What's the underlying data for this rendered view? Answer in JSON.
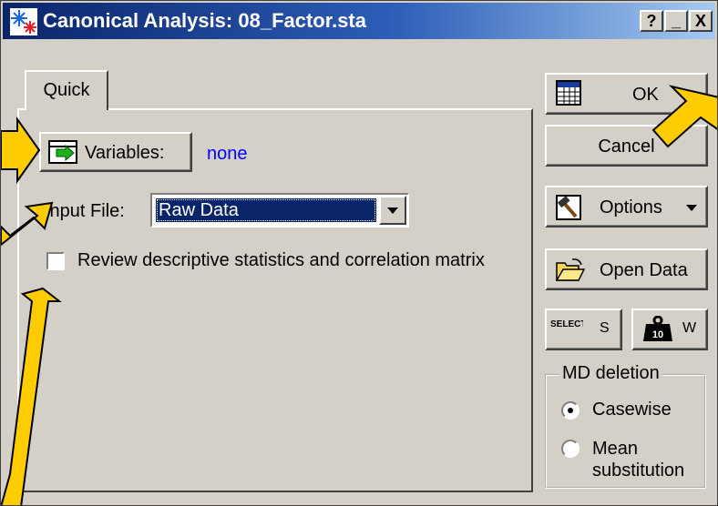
{
  "window": {
    "title": "Canonical Analysis: 08_Factor.sta",
    "help_button": "?",
    "minimize_button": "_",
    "close_button": "X"
  },
  "tabs": [
    {
      "label": "Quick",
      "selected": true
    }
  ],
  "quick": {
    "variables_button": "Variables:",
    "variables_value": "none",
    "input_file_label": "Input File:",
    "input_file_value": "Raw Data",
    "review_checkbox_label": "Review descriptive statistics and correlation matrix",
    "review_checked": false
  },
  "side_buttons": {
    "ok": "OK",
    "cancel": "Cancel",
    "options": "Options",
    "open_data": "Open Data",
    "select_cases_icon_text": "SELECT CASES",
    "select_cases_key": "S",
    "weight_icon_text": "10",
    "weight_key": "W"
  },
  "md_deletion": {
    "title": "MD deletion",
    "options": [
      "Casewise",
      "Mean substitution"
    ],
    "selected": "Casewise"
  },
  "colors": {
    "dialog": "#d4d0c8",
    "titlebar": "#0a246a",
    "link": "#0000ff",
    "highlight": "#0a246a",
    "arrow": "#ffcc00"
  }
}
